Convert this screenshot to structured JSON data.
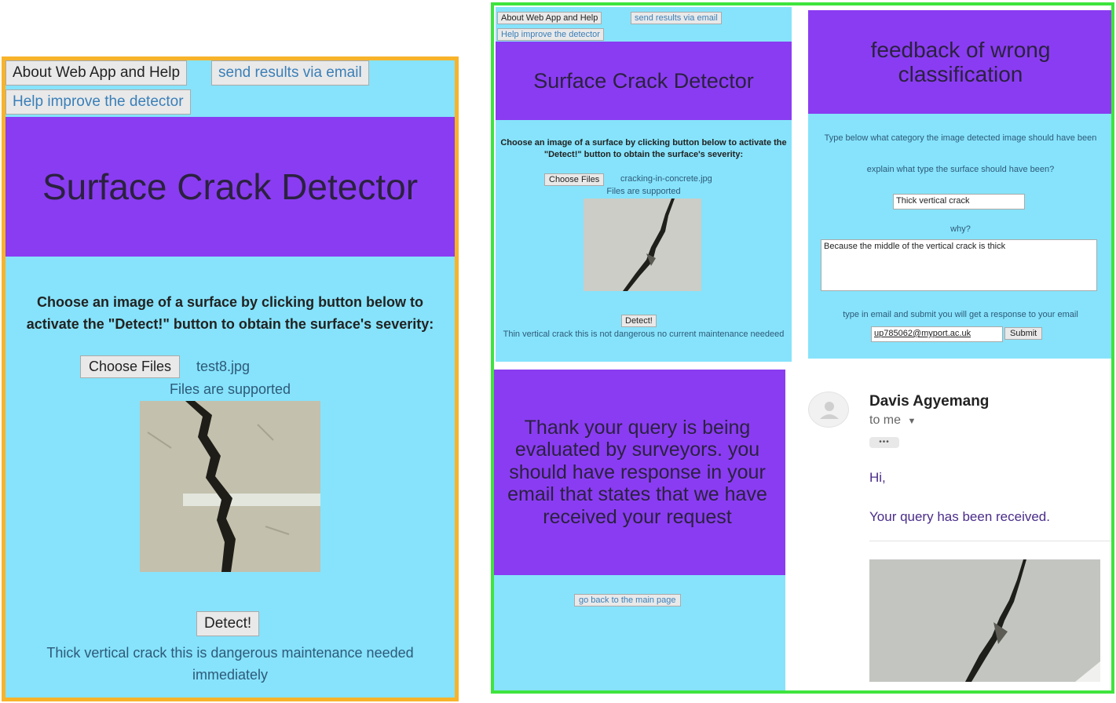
{
  "left_panel": {
    "nav": {
      "about": "About Web App and Help",
      "email": "send results via email",
      "improve": "Help improve the detector"
    },
    "title": "Surface Crack Detector",
    "instructions": "Choose an image of a surface by clicking button below to activate the \"Detect!\" button to obtain the surface's severity:",
    "choose_button": "Choose Files",
    "file_name": "test8.jpg",
    "supported": "Files are supported",
    "detect_button": "Detect!",
    "result": "Thick vertical crack this is dangerous maintenance needed immediately"
  },
  "right_panel": {
    "main_page": {
      "nav": {
        "about": "About Web App and Help",
        "email": "send results via email",
        "improve": "Help improve the detector"
      },
      "title": "Surface Crack Detector",
      "instructions": "Choose an image of a surface by clicking button below to activate the \"Detect!\" button to obtain the surface's severity:",
      "choose_button": "Choose Files",
      "file_name": "cracking-in-concrete.jpg",
      "supported": "Files are supported",
      "detect_button": "Detect!",
      "result": "Thin vertical crack this is not dangerous no current maintenance needeed"
    },
    "feedback": {
      "title": "feedback of wrong classification",
      "category_prompt": "Type below what category the image detected image should have been",
      "explain_prompt": "explain what type the surface should have been?",
      "category_value": "Thick vertical crack",
      "why_label": "why?",
      "why_value": "Because the middle of the vertical crack is thick",
      "email_prompt": "type in email and submit you will get a response to your email",
      "email_value": "up785062@myport.ac.uk",
      "submit_button": "Submit"
    },
    "thank_you": {
      "message": "Thank your query is being evaluated by surveyors. you should have response in your email that states that we have received your request",
      "back_button": "go back to the main page"
    },
    "email": {
      "sender": "Davis Agyemang",
      "to": "to me",
      "dots": "•••",
      "greeting": "Hi,",
      "body": "Your query has been received."
    }
  },
  "colors": {
    "panel_bg": "#86e3fb",
    "header_bg": "#8a3cf2",
    "left_border": "#f7b32a",
    "right_border": "#3ee43e"
  }
}
